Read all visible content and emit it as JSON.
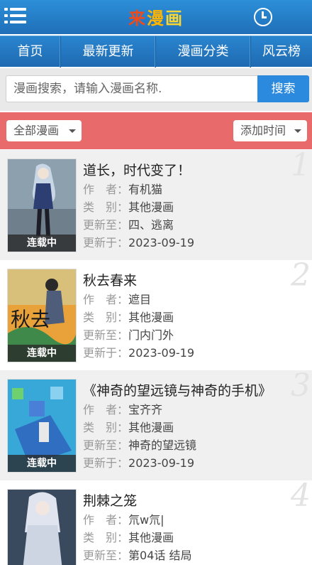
{
  "header": {
    "logo_part1": "来",
    "logo_part2": "漫",
    "logo_part3": "画"
  },
  "nav": [
    {
      "label": "首页"
    },
    {
      "label": "最新更新"
    },
    {
      "label": "漫画分类"
    },
    {
      "label": "风云榜"
    }
  ],
  "search": {
    "placeholder": "漫画搜索，请输入漫画名称.",
    "button_label": "搜索"
  },
  "filter": {
    "category_selected": "全部漫画",
    "sort_selected": "添加时间"
  },
  "labels": {
    "author": "作　者：",
    "category": "类　别：",
    "updated_to": "更新至：",
    "updated_on": "更新于："
  },
  "comics": [
    {
      "index": "1",
      "title": "道长，时代变了！",
      "author": "有机猫",
      "category": "其他漫画",
      "updated_to": "四、逃离",
      "updated_on": "2023-09-19",
      "badge": "连载中"
    },
    {
      "index": "2",
      "title": "秋去春来",
      "author": "遮目",
      "category": "其他漫画",
      "updated_to": "门内门外",
      "updated_on": "2023-09-19",
      "badge": "连载中"
    },
    {
      "index": "3",
      "title": "《神奇的望远镜与神奇的手机》",
      "author": "宝齐齐",
      "category": "其他漫画",
      "updated_to": "神奇的望远镜",
      "updated_on": "2023-09-19",
      "badge": "连载中"
    },
    {
      "index": "4",
      "title": "荆棘之笼",
      "author": "氘w氘|",
      "category": "其他漫画",
      "updated_to": "第04话 结局",
      "updated_on": "",
      "badge": ""
    }
  ]
}
